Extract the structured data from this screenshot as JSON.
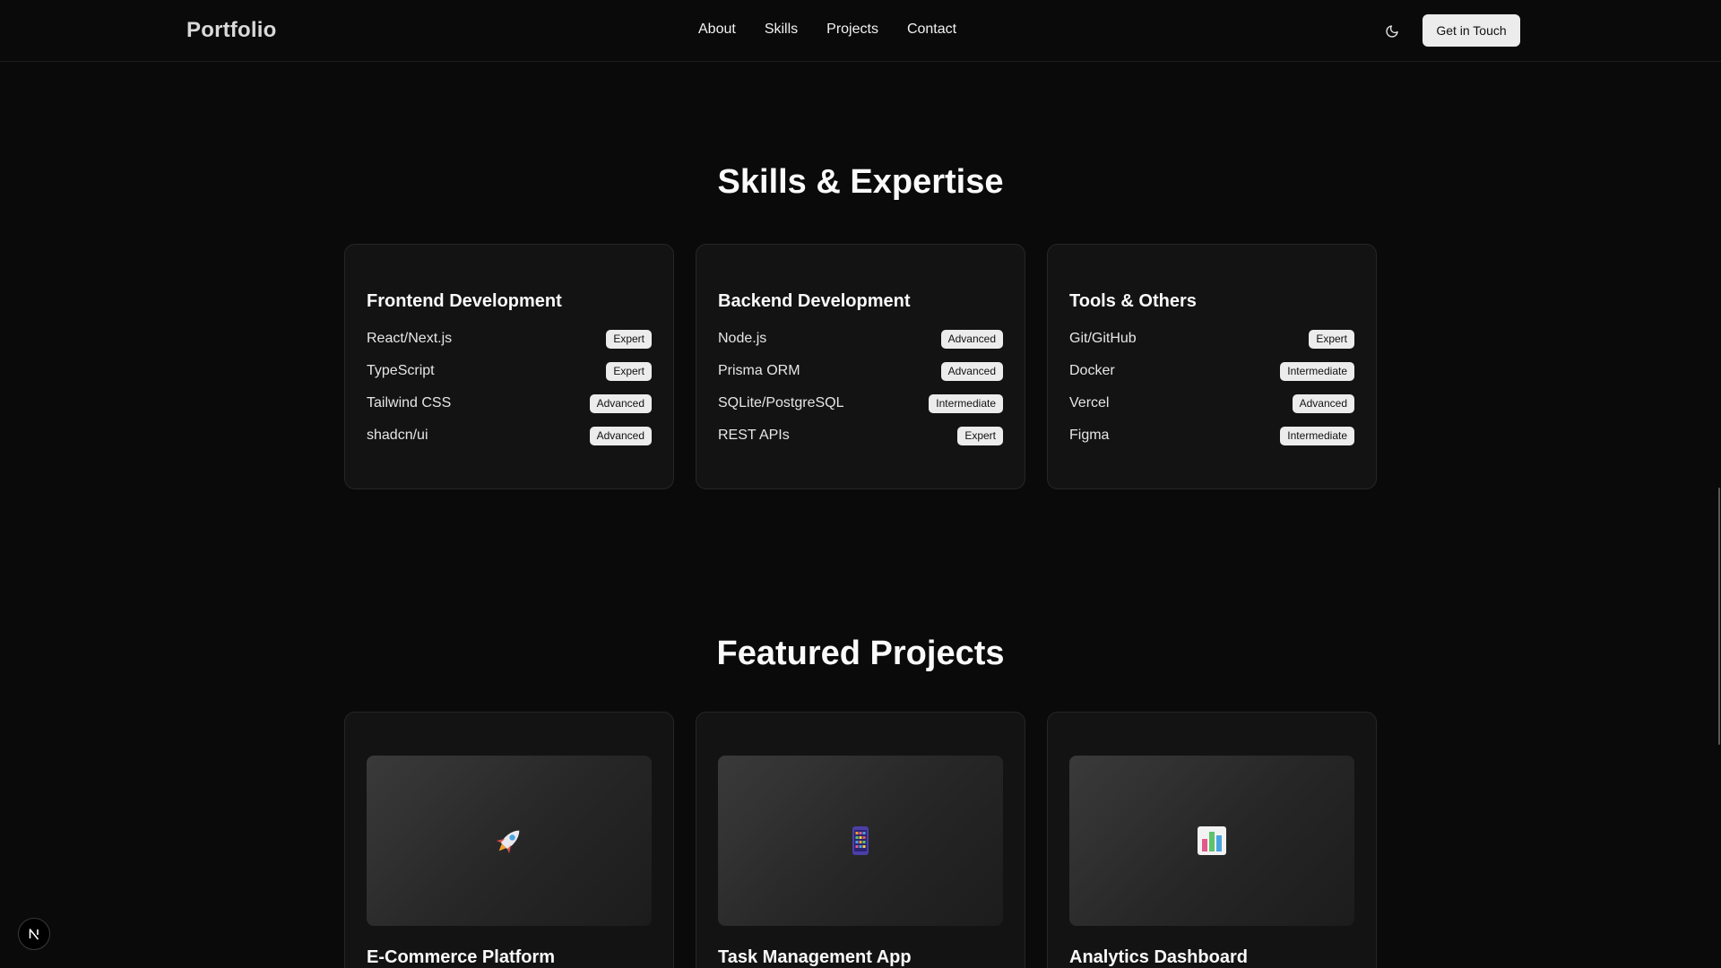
{
  "header": {
    "brand": "Portfolio",
    "nav": [
      "About",
      "Skills",
      "Projects",
      "Contact"
    ],
    "theme_icon": "moon-icon",
    "cta_label": "Get in Touch"
  },
  "skills": {
    "title": "Skills & Expertise",
    "categories": [
      {
        "title": "Frontend Development",
        "items": [
          {
            "name": "React/Next.js",
            "level": "Expert"
          },
          {
            "name": "TypeScript",
            "level": "Expert"
          },
          {
            "name": "Tailwind CSS",
            "level": "Advanced"
          },
          {
            "name": "shadcn/ui",
            "level": "Advanced"
          }
        ]
      },
      {
        "title": "Backend Development",
        "items": [
          {
            "name": "Node.js",
            "level": "Advanced"
          },
          {
            "name": "Prisma ORM",
            "level": "Advanced"
          },
          {
            "name": "SQLite/PostgreSQL",
            "level": "Intermediate"
          },
          {
            "name": "REST APIs",
            "level": "Expert"
          }
        ]
      },
      {
        "title": "Tools & Others",
        "items": [
          {
            "name": "Git/GitHub",
            "level": "Expert"
          },
          {
            "name": "Docker",
            "level": "Intermediate"
          },
          {
            "name": "Vercel",
            "level": "Advanced"
          },
          {
            "name": "Figma",
            "level": "Intermediate"
          }
        ]
      }
    ]
  },
  "projects": {
    "title": "Featured Projects",
    "items": [
      {
        "title": "E-Commerce Platform",
        "icon": "rocket-icon"
      },
      {
        "title": "Task Management App",
        "icon": "mobile-app-icon"
      },
      {
        "title": "Analytics Dashboard",
        "icon": "bar-chart-icon"
      }
    ]
  },
  "next_badge": "N"
}
